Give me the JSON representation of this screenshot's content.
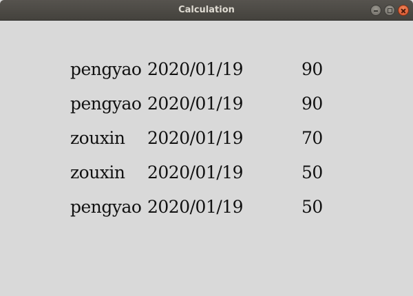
{
  "window": {
    "title": "Calculation",
    "controls": [
      "minimize-icon",
      "maximize-icon",
      "close-icon"
    ]
  },
  "records": [
    {
      "name": "pengyao",
      "date": "2020/01/19",
      "score": "90"
    },
    {
      "name": "pengyao",
      "date": "2020/01/19",
      "score": "90"
    },
    {
      "name": "zouxin",
      "date": "2020/01/19",
      "score": "70"
    },
    {
      "name": "zouxin",
      "date": "2020/01/19",
      "score": "50"
    },
    {
      "name": "pengyao",
      "date": "2020/01/19",
      "score": "50"
    }
  ]
}
